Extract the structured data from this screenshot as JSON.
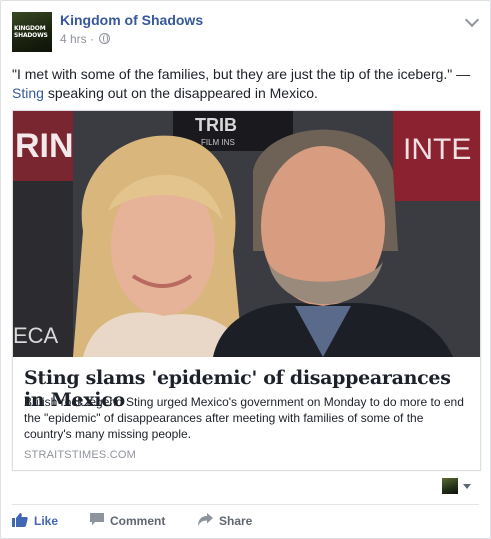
{
  "post": {
    "page_name": "Kingdom of Shadows",
    "avatar_text": [
      "KINGDOM",
      "SHADOWS"
    ],
    "timestamp": "4 hrs",
    "separator": "·",
    "privacy_icon": "globe-icon",
    "options_icon": "chevron-down-icon",
    "text_before": "\"I met with some of the families, but they are just the tip of the iceberg.\" —",
    "text_link": "Sting",
    "text_after": "speaking out on the disappeared in Mexico."
  },
  "link": {
    "title": "Sting slams 'epidemic' of disappearances in Mexico",
    "description": "British rock legend Sting urged Mexico's government on Monday to do more to end the \"epidemic\" of disappearances after meeting with families of some of the country's many missing people.",
    "domain": "STRAITSTIMES.COM",
    "backdrop_text": [
      "RIN",
      "TRIB",
      "FILM INS",
      "INTE",
      "ECA"
    ]
  },
  "actions": {
    "like": "Like",
    "comment": "Comment",
    "share": "Share"
  },
  "colors": {
    "link_blue": "#365899",
    "like_blue": "#4267b2",
    "meta_gray": "#90949c",
    "text": "#1d2129"
  }
}
